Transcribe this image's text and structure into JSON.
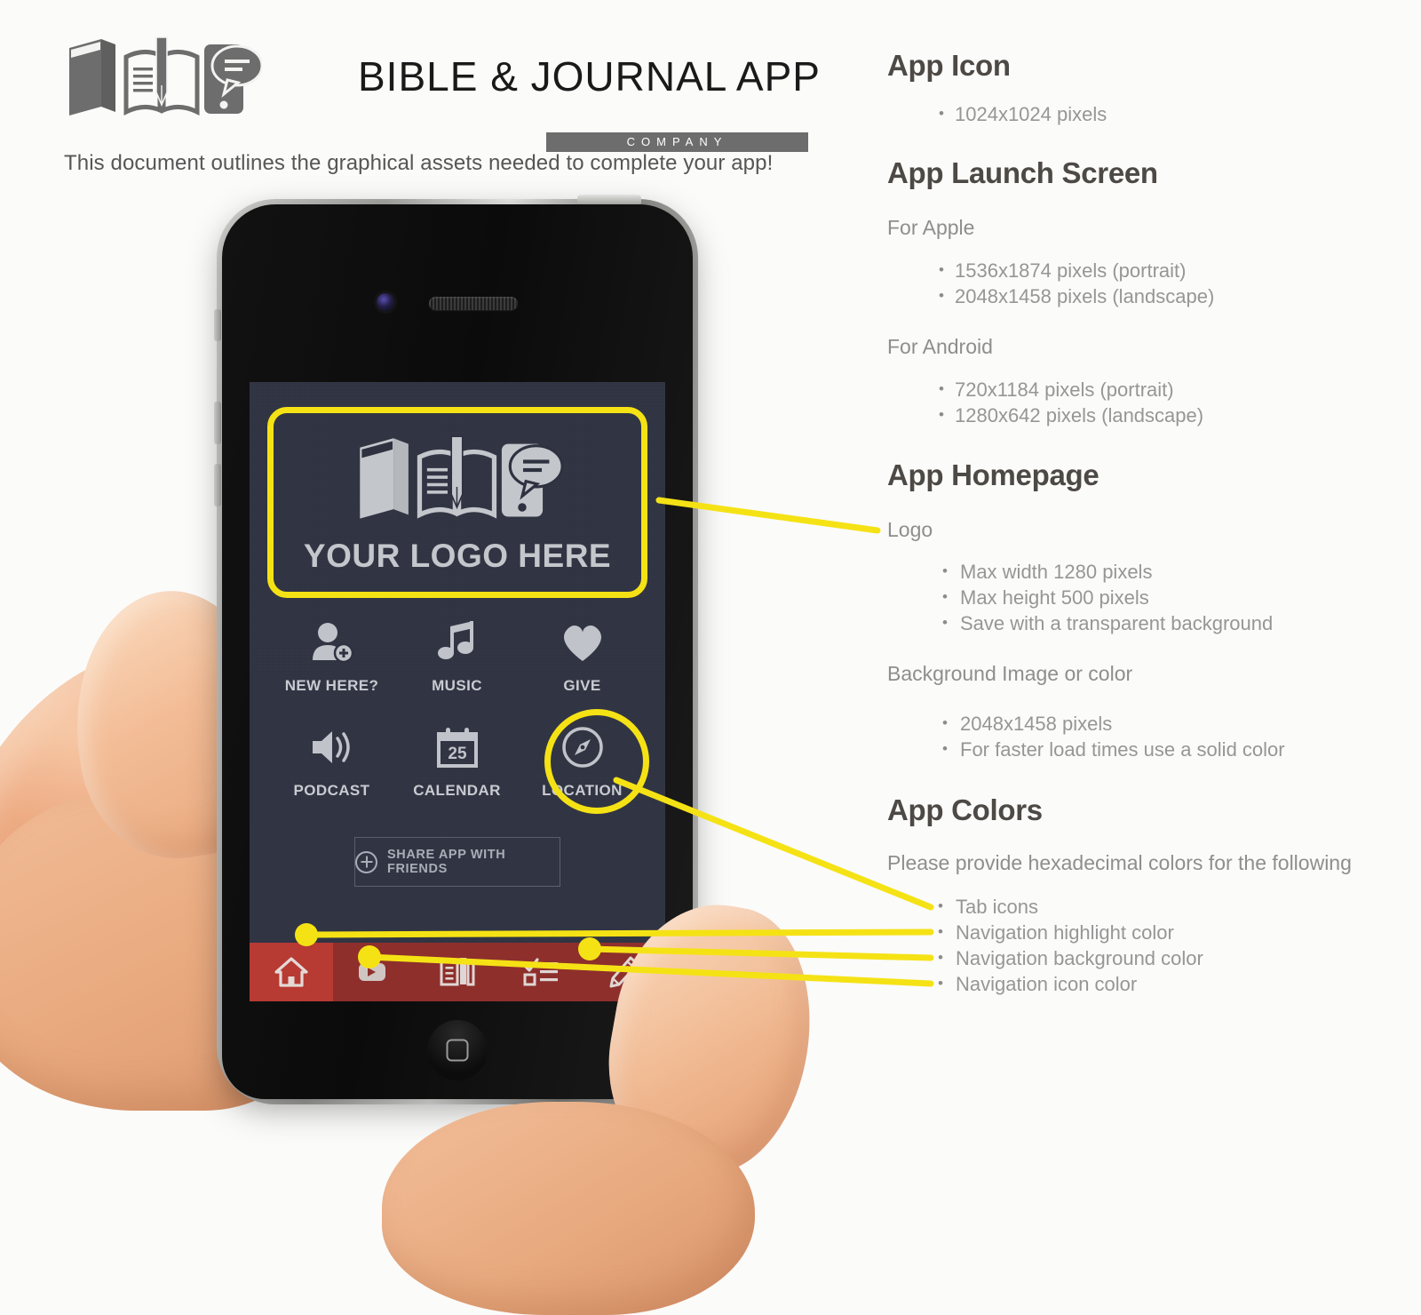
{
  "header": {
    "brand_title": "BIBLE & JOURNAL APP",
    "brand_subtitle": "COMPANY",
    "brand_icons": [
      "closed-book-icon",
      "open-book-pen-icon",
      "phone-chat-icon"
    ],
    "tagline": "This document outlines the graphical assets needed to complete your app!"
  },
  "sections": [
    {
      "id": "app-icon",
      "title": "App Icon",
      "bullets": [
        "1024x1024 pixels"
      ]
    },
    {
      "id": "app-launch-screen",
      "title": "App Launch Screen",
      "groups": [
        {
          "label": "For Apple",
          "bullets": [
            "1536x1874 pixels (portrait)",
            "2048x1458 pixels (landscape)"
          ]
        },
        {
          "label": "For Android",
          "bullets": [
            "720x1184 pixels (portrait)",
            "1280x642 pixels (landscape)"
          ]
        }
      ]
    },
    {
      "id": "app-homepage",
      "title": "App Homepage",
      "groups": [
        {
          "label": "Logo",
          "bullets": [
            "Max width 1280 pixels",
            "Max height 500 pixels",
            "Save with a transparent background"
          ]
        },
        {
          "label": "Background Image or color",
          "bullets": [
            "2048x1458 pixels",
            "For faster load times use a solid color"
          ]
        }
      ]
    },
    {
      "id": "app-colors",
      "title": "App Colors",
      "groups": [
        {
          "label": "Please provide hexadecimal colors for the following",
          "bullets": [
            "Tab icons",
            "Navigation highlight color",
            "Navigation background color",
            "Navigation icon color"
          ]
        }
      ]
    }
  ],
  "phone": {
    "screen": {
      "logo_placeholder_text": "YOUR LOGO HERE",
      "logo_icons": [
        "closed-book-icon",
        "open-book-pen-icon",
        "phone-chat-icon"
      ],
      "grid_items": [
        {
          "label": "NEW HERE?",
          "icon": "person-add-icon"
        },
        {
          "label": "MUSIC",
          "icon": "music-note-icon"
        },
        {
          "label": "GIVE",
          "icon": "heart-icon"
        },
        {
          "label": "PODCAST",
          "icon": "speaker-icon"
        },
        {
          "label": "CALENDAR",
          "icon": "calendar-icon",
          "day": "25"
        },
        {
          "label": "LOCATION",
          "icon": "compass-icon"
        }
      ],
      "share_button_label": "SHARE APP WITH FRIENDS",
      "share_button_icon": "plus-circle-icon",
      "nav_items": [
        {
          "icon": "home-icon",
          "active": true
        },
        {
          "icon": "video-icon",
          "active": false
        },
        {
          "icon": "book-shelf-icon",
          "active": false
        },
        {
          "icon": "checklist-icon",
          "active": false
        },
        {
          "icon": "pencil-icon",
          "active": false
        }
      ]
    },
    "hardware": {
      "camera": "front-camera",
      "speaker": "earpiece-speaker",
      "home_button": "home-button",
      "side_buttons": [
        "silent-switch",
        "volume-up-button",
        "volume-down-button",
        "power-button"
      ]
    }
  },
  "colors": {
    "callout_yellow": "#f5e215",
    "nav_background": "#8e2f2c",
    "nav_highlight": "#b73a33",
    "screen_background": "#2e3240",
    "heading_gray": "#4d4945",
    "body_gray": "#969696",
    "brand_dark": "#1a1a1a"
  },
  "callouts": [
    {
      "name": "logo-callout",
      "target": "logo-zone",
      "label": "Logo"
    },
    {
      "name": "tab-icons-callout",
      "target": "location-tile",
      "label": "Tab icons"
    },
    {
      "name": "nav-highlight-callout",
      "target": "nav-home-highlight",
      "label": "Navigation highlight color"
    },
    {
      "name": "nav-background-callout",
      "target": "nav-bar",
      "label": "Navigation background color"
    },
    {
      "name": "nav-icon-callout",
      "target": "nav-video-icon",
      "label": "Navigation icon color"
    }
  ]
}
